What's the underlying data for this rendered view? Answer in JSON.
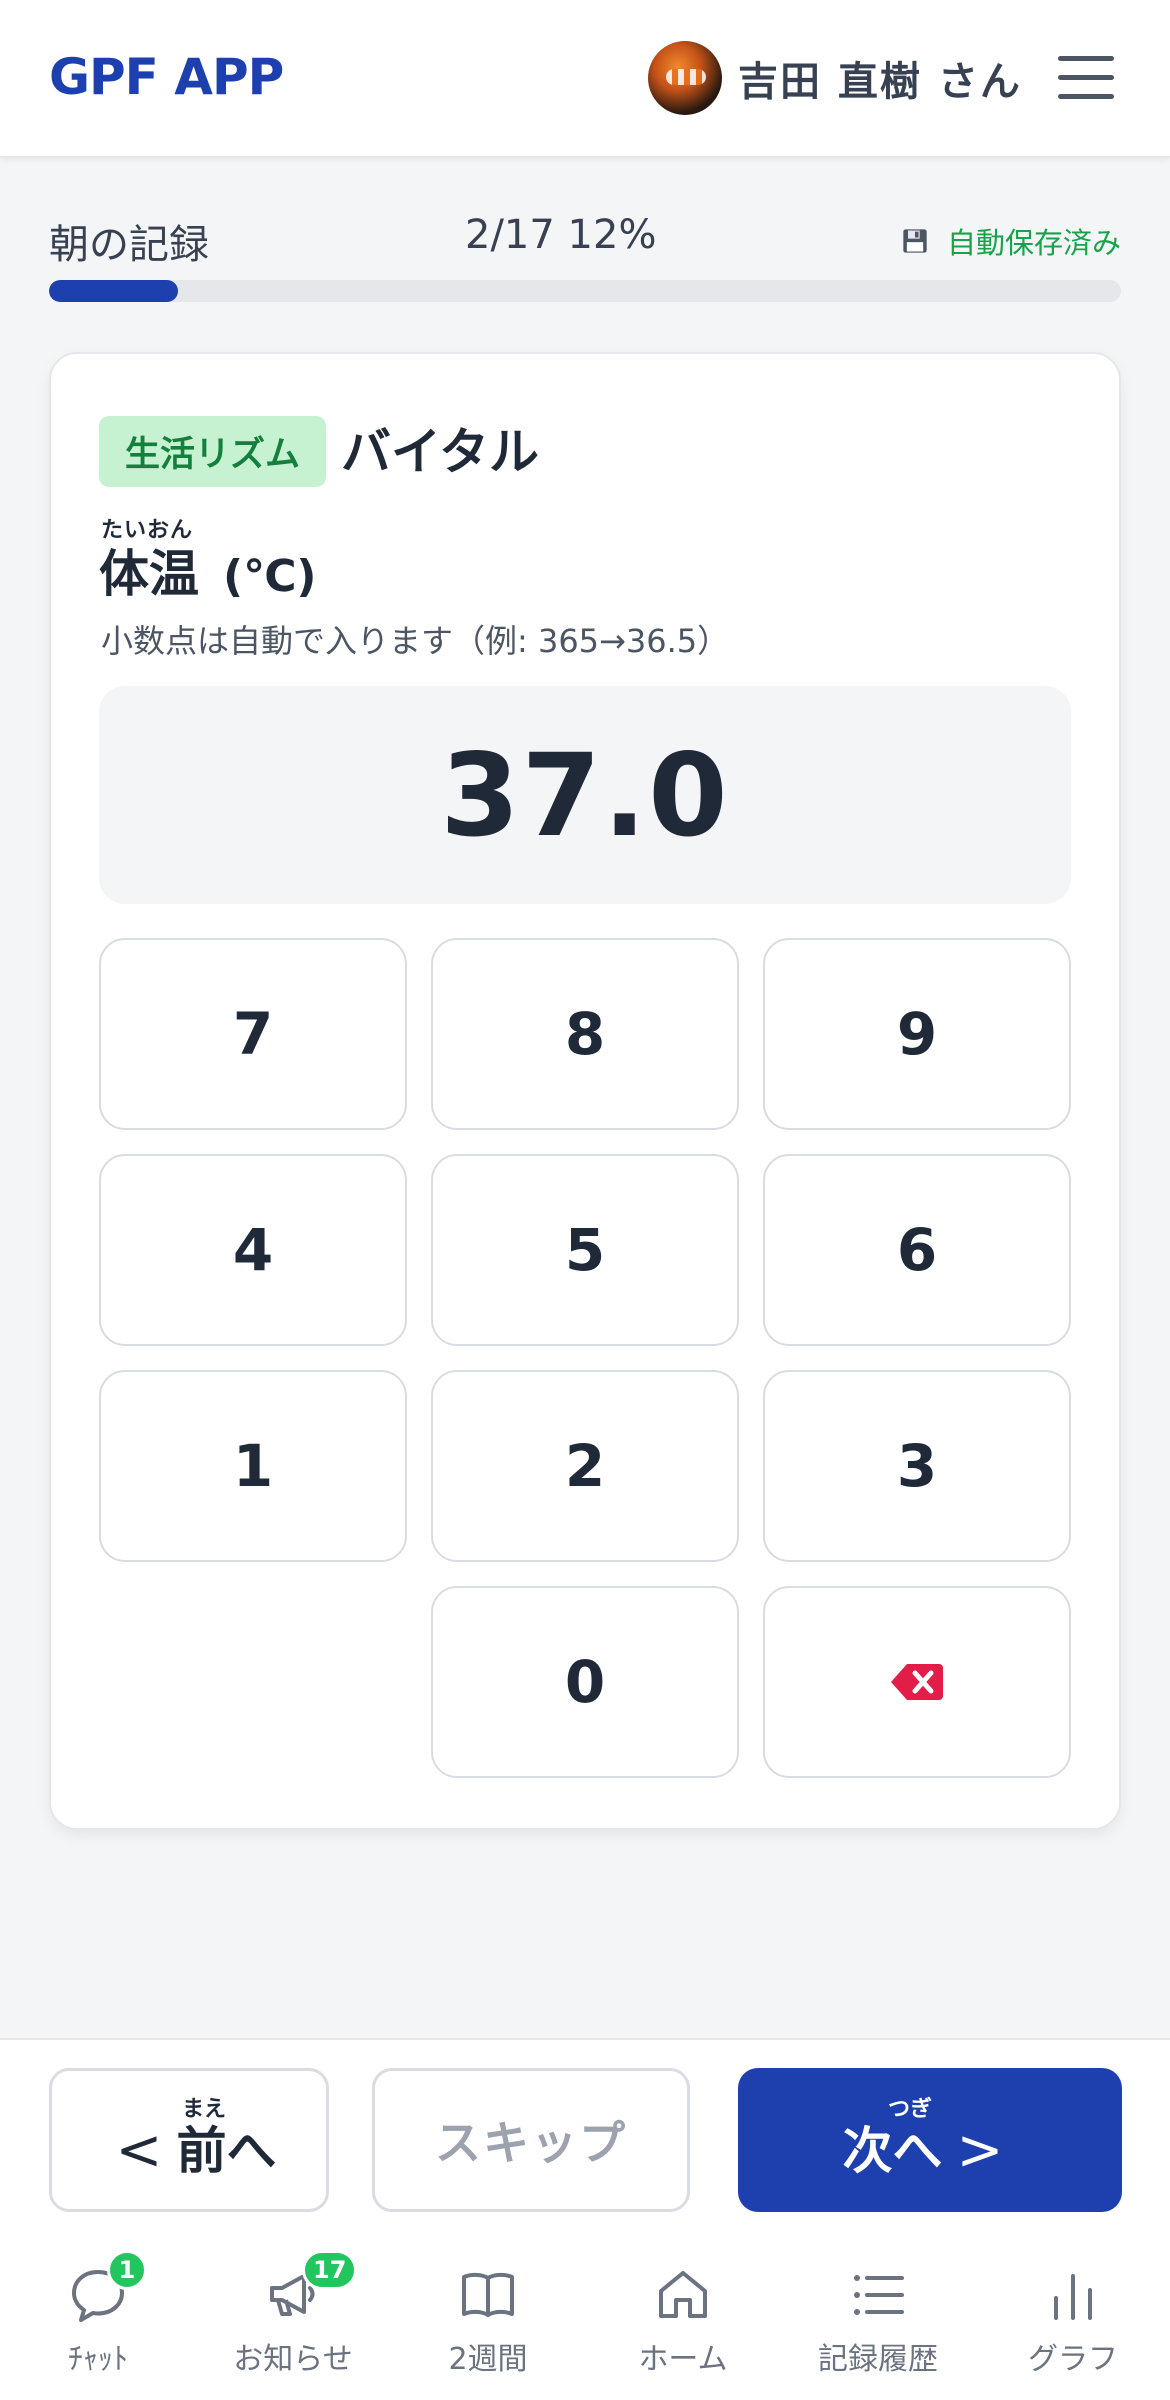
{
  "header": {
    "brand": "GPF APP",
    "user_name": "吉田 直樹 さん"
  },
  "progress": {
    "label": "朝の記録",
    "count": "2/17 12%",
    "percent": 12,
    "autosave": "自動保存済み",
    "fill_color": "#1e3fae"
  },
  "question": {
    "badge": "生活リズム",
    "category": "バイタル",
    "ruby": "たいおん",
    "title": "体温",
    "unit": "(℃)",
    "hint": "小数点は自動で入ります（例: 365→36.5）",
    "value": "37.0"
  },
  "keypad": {
    "keys": [
      "7",
      "8",
      "9",
      "4",
      "5",
      "6",
      "1",
      "2",
      "3",
      "0"
    ],
    "backspace_icon": "backspace-icon"
  },
  "actions": {
    "prev_ruby": "まえ",
    "prev_label": "前へ",
    "skip_label": "スキップ",
    "next_ruby": "つぎ",
    "next_label": "次へ"
  },
  "nav": {
    "items": [
      {
        "label": "ﾁｬｯﾄ",
        "icon": "chat-icon",
        "badge": "1"
      },
      {
        "label": "お知らせ",
        "icon": "megaphone-icon",
        "badge": "17"
      },
      {
        "label": "2週間",
        "icon": "book-icon"
      },
      {
        "label": "ホーム",
        "icon": "home-icon"
      },
      {
        "label": "記録履歴",
        "icon": "list-icon"
      },
      {
        "label": "グラフ",
        "icon": "bar-chart-icon"
      }
    ],
    "badge_color": "#22c55e"
  }
}
